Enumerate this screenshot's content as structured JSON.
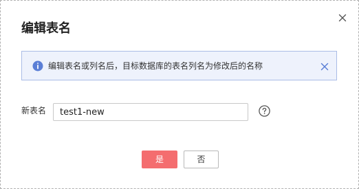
{
  "dialog": {
    "title": "编辑表名",
    "close_icon": "close-icon"
  },
  "alert": {
    "icon": "info-icon",
    "message": "编辑表名或列名后，目标数据库的表名列名为修改后的名称",
    "close_icon": "close-icon",
    "accent_color": "#5b7fd6",
    "background_color": "#eef2fc"
  },
  "form": {
    "label": "新表名",
    "value": "test1-new",
    "help_icon": "question-circle-icon"
  },
  "buttons": {
    "confirm_label": "是",
    "cancel_label": "否",
    "confirm_color": "#f46d6f"
  }
}
